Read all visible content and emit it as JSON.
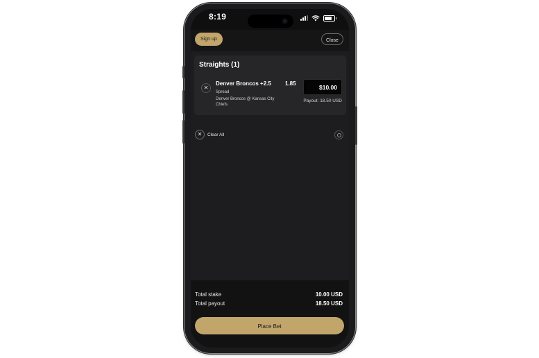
{
  "status_bar": {
    "time": "8:19"
  },
  "header": {
    "signup_label": "Sign up",
    "close_label": "Close"
  },
  "betslip": {
    "section_title": "Straights (1)",
    "selection": {
      "name": "Denver Broncos +2.5",
      "odds": "1.85",
      "market": "Spread",
      "event": "Denver Broncos @ Kansas City Chiefs",
      "stake_value": "$10.00",
      "payout_text": "Payout: 18.50 USD"
    },
    "clear_all_label": "Clear All"
  },
  "footer": {
    "total_stake_label": "Total stake",
    "total_stake_value": "10.00 USD",
    "total_payout_label": "Total payout",
    "total_payout_value": "18.50 USD",
    "place_bet_label": "Place Bet"
  },
  "icons": {
    "remove": "close-icon",
    "clear": "close-icon",
    "settings": "gear-icon"
  },
  "colors": {
    "accent_gold": "#c2a56b",
    "background": "#1d1d1f",
    "card": "#262628"
  }
}
